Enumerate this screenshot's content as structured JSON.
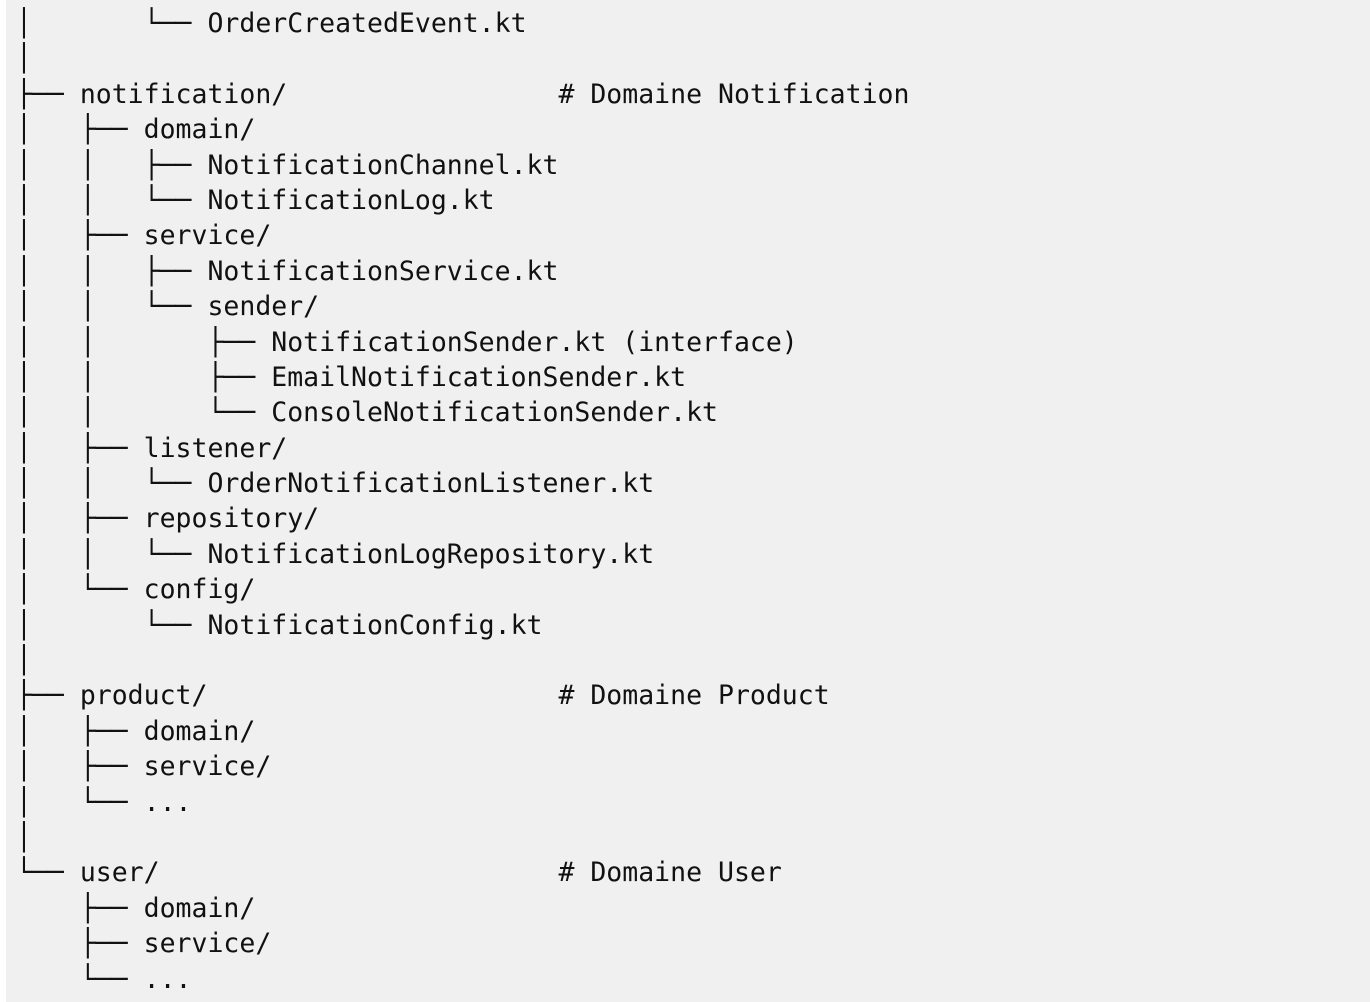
{
  "tree": {
    "lines": [
      "│       └── OrderCreatedEvent.kt",
      "│",
      "├── notification/                 # Domaine Notification",
      "│   ├── domain/",
      "│   │   ├── NotificationChannel.kt",
      "│   │   └── NotificationLog.kt",
      "│   ├── service/",
      "│   │   ├── NotificationService.kt",
      "│   │   └── sender/",
      "│   │       ├── NotificationSender.kt (interface)",
      "│   │       ├── EmailNotificationSender.kt",
      "│   │       └── ConsoleNotificationSender.kt",
      "│   ├── listener/",
      "│   │   └── OrderNotificationListener.kt",
      "│   ├── repository/",
      "│   │   └── NotificationLogRepository.kt",
      "│   └── config/",
      "│       └── NotificationConfig.kt",
      "│",
      "├── product/                      # Domaine Product",
      "│   ├── domain/",
      "│   ├── service/",
      "│   └── ...",
      "│",
      "└── user/                         # Domaine User",
      "    ├── domain/",
      "    ├── service/",
      "    └── ..."
    ]
  }
}
